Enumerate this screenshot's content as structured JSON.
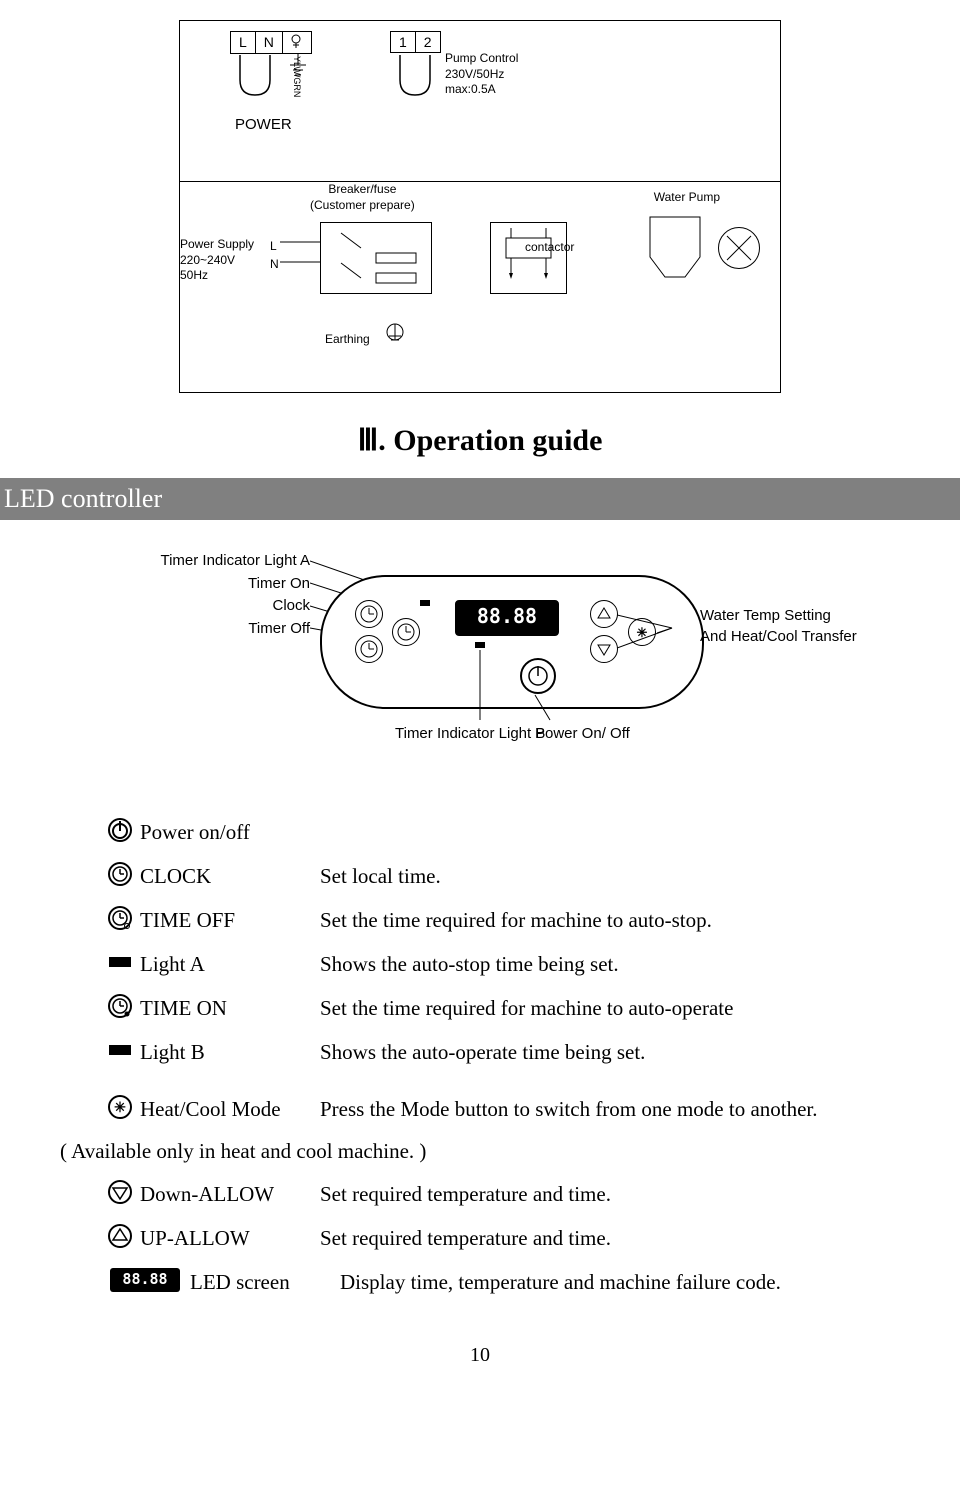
{
  "wiring": {
    "L": "L",
    "N": "N",
    "ylw_grn": "YLW/GRN",
    "power": "POWER",
    "one": "1",
    "two": "2",
    "pump_control_l1": "Pump Control",
    "pump_control_l2": "230V/50Hz",
    "pump_control_l3": "max:0.5A",
    "breaker_l1": "Breaker/fuse",
    "breaker_l2": "(Customer prepare)",
    "water_pump": "Water Pump",
    "power_supply_l1": "Power Supply",
    "power_supply_l2": "220~240V",
    "power_supply_l3": "50Hz",
    "L2": "L",
    "N2": "N",
    "contactor": "contactor",
    "earthing": "Earthing"
  },
  "section_title": "Ⅲ. Operation guide",
  "led_banner": "LED controller",
  "controller_fig": {
    "timer_ind_a": "Timer Indicator Light A",
    "timer_on": "Timer On",
    "clock": "Clock",
    "timer_off": "Timer Off",
    "lcd": "88.88",
    "right_l1": "Water Temp Setting",
    "right_l2": "And Heat/Cool Transfer",
    "bottom_b": "Timer Indicator Light B",
    "power_onoff": "Power On/ Off"
  },
  "rows": {
    "power_onoff": "Power on/off",
    "clock_label": "CLOCK",
    "clock_desc": "Set local time.",
    "timeoff_label": "TIME OFF",
    "timeoff_desc": "Set the time required for machine to auto-stop.",
    "lighta_label": "Light A",
    "lighta_desc": "Shows the auto-stop time being set.",
    "timeon_label": "TIME ON",
    "timeon_desc": "Set the time required for machine to auto-operate",
    "lightb_label": "Light B",
    "lightb_desc": "Shows the auto-operate time being set.",
    "heatcool_label": "Heat/Cool Mode",
    "heatcool_desc": "Press the Mode button to switch from one mode to another.",
    "note": "( Available only in heat and cool machine. )",
    "down_label": "Down-ALLOW",
    "down_desc": "Set required temperature and time.",
    "up_label": "UP-ALLOW",
    "up_desc": "Set required temperature and time.",
    "led_label": "LED screen",
    "led_desc": "Display time, temperature and machine failure code.",
    "lcd_icon": "88.88"
  },
  "page_num": "10"
}
